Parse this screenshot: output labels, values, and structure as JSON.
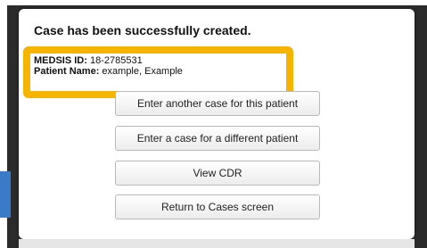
{
  "dialog": {
    "title": "Case has been successfully created.",
    "medsis_id_label": "MEDSIS ID:",
    "medsis_id_value": " 18-2785531",
    "patient_name_label": "Patient Name:",
    "patient_name_value": " example, Example"
  },
  "buttons": {
    "enter_another_case": "Enter another case for this patient",
    "enter_different_patient": "Enter a case for a different patient",
    "view_cdr": "View CDR",
    "return_to_cases": "Return to Cases screen"
  },
  "colors": {
    "highlight": "#f4b400",
    "accent_tab": "#3a7bc8",
    "backdrop": "#2b2b2b"
  }
}
